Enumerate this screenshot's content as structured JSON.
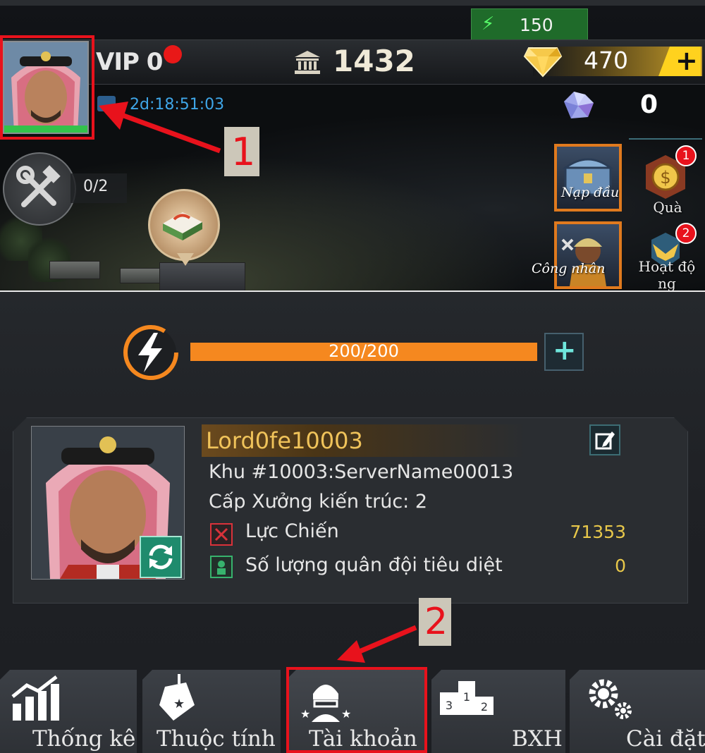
{
  "hud": {
    "energy": "150",
    "vip": "VIP 0",
    "gold": "1432",
    "gems": "470",
    "gem_plus": "+",
    "crystals": "0",
    "timer": "2d:18:51:03",
    "build_queue": "0/2"
  },
  "side_buttons": {
    "first_recharge": "Nạp đầu",
    "worker": "Công nhân",
    "gift": "Quà",
    "gift_badge": "1",
    "events_line1": "Hoạt độ",
    "events_line2": "ng",
    "events_badge": "2"
  },
  "annotations": {
    "step1": "1",
    "step2": "2",
    "highlight_color": "#e8121c"
  },
  "profile": {
    "energy_bar": "200/200",
    "energy_fraction": 1.0,
    "energy_plus": "+",
    "name": "Lord0fe10003",
    "server": "Khu #10003:ServerName00013",
    "level_label": "Cấp Xưởng kiến trúc:",
    "level_value": "2",
    "combat_label": "Lực Chiến",
    "combat_value": "71353",
    "kills_label": "Số lượng quân đội tiêu diệt",
    "kills_value": "0"
  },
  "tabs": [
    {
      "label": "Thống kê",
      "icon": "stats-chart-icon"
    },
    {
      "label": "Thuộc tính",
      "icon": "tag-icon"
    },
    {
      "label": "Tài khoản",
      "icon": "soldier-icon"
    },
    {
      "label": "BXH",
      "icon": "podium-icon"
    },
    {
      "label": "Cài đặt",
      "icon": "gears-icon"
    }
  ]
}
